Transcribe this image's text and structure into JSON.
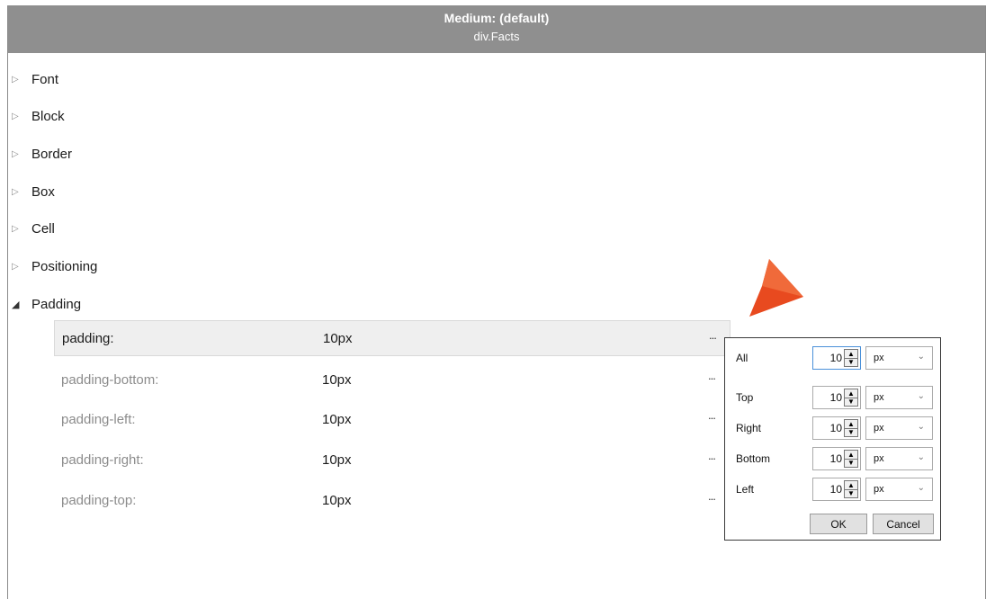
{
  "header": {
    "title": "Medium: (default)",
    "subtitle": "div.Facts"
  },
  "categories": [
    {
      "label": "Font",
      "expanded": false
    },
    {
      "label": "Block",
      "expanded": false
    },
    {
      "label": "Border",
      "expanded": false
    },
    {
      "label": "Box",
      "expanded": false
    },
    {
      "label": "Cell",
      "expanded": false
    },
    {
      "label": "Positioning",
      "expanded": false
    },
    {
      "label": "Padding",
      "expanded": true
    }
  ],
  "padding_props": [
    {
      "name": "padding:",
      "value": "10px",
      "more": "..."
    },
    {
      "name": "padding-bottom:",
      "value": "10px",
      "more": "..."
    },
    {
      "name": "padding-left:",
      "value": "10px",
      "more": "..."
    },
    {
      "name": "padding-right:",
      "value": "10px",
      "more": "..."
    },
    {
      "name": "padding-top:",
      "value": "10px",
      "more": "..."
    }
  ],
  "popup": {
    "rows": [
      {
        "label": "All",
        "value": "10",
        "unit": "px"
      },
      {
        "label": "Top",
        "value": "10",
        "unit": "px"
      },
      {
        "label": "Right",
        "value": "10",
        "unit": "px"
      },
      {
        "label": "Bottom",
        "value": "10",
        "unit": "px"
      },
      {
        "label": "Left",
        "value": "10",
        "unit": "px"
      }
    ],
    "ok_label": "OK",
    "cancel_label": "Cancel"
  },
  "colors": {
    "header_bg": "#8f8f8f",
    "pointer": "#e84a1f",
    "focus_border": "#4a90d9"
  },
  "icons": {
    "collapsed": "triangle-right-icon",
    "expanded": "triangle-down-icon",
    "pointer": "callout-arrow-icon"
  }
}
